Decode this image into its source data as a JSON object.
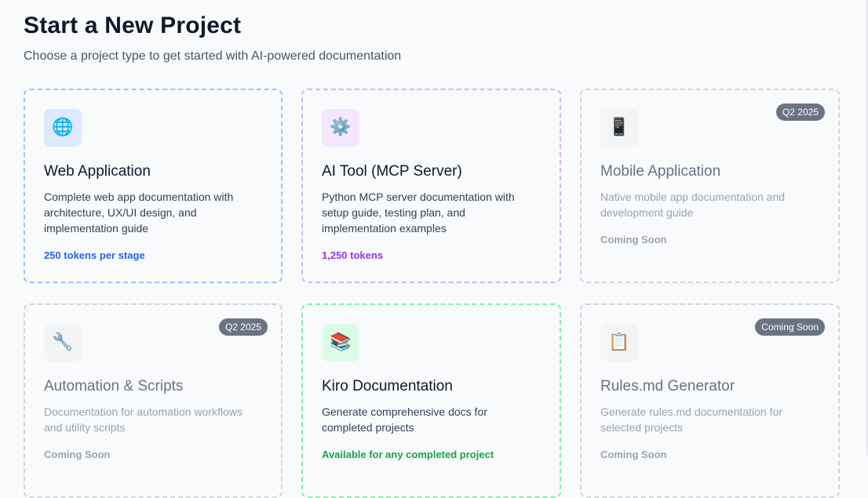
{
  "header": {
    "title": "Start a New Project",
    "subtitle": "Choose a project type to get started with AI-powered documentation"
  },
  "cards": [
    {
      "icon": "🌐",
      "icon_name": "globe-icon",
      "title": "Web Application",
      "description": "Complete web app documentation with architecture, UX/UI design, and implementation guide",
      "footer": "250 tokens per stage",
      "accent": "#2563eb"
    },
    {
      "icon": "⚙️",
      "icon_name": "gear-icon",
      "title": "AI Tool (MCP Server)",
      "description": "Python MCP server documentation with setup guide, testing plan, and implementation examples",
      "footer": "1,250 tokens",
      "accent": "#9333ea"
    },
    {
      "icon": "📱",
      "icon_name": "mobile-phone-icon",
      "title": "Mobile Application",
      "description": "Native mobile app documentation and development guide",
      "footer": "Coming Soon",
      "badge": "Q2 2025"
    },
    {
      "icon": "🔧",
      "icon_name": "wrench-icon",
      "title": "Automation & Scripts",
      "description": "Documentation for automation workflows and utility scripts",
      "footer": "Coming Soon",
      "badge": "Q2 2025"
    },
    {
      "icon": "📚",
      "icon_name": "books-icon",
      "title": "Kiro Documentation",
      "description": "Generate comprehensive docs for completed projects",
      "footer": "Available for any completed project",
      "accent": "#16a34a"
    },
    {
      "icon": "📋",
      "icon_name": "clipboard-icon",
      "title": "Rules.md Generator",
      "description": "Generate rules.md documentation for selected projects",
      "footer": "Coming Soon",
      "badge": "Coming Soon"
    }
  ]
}
